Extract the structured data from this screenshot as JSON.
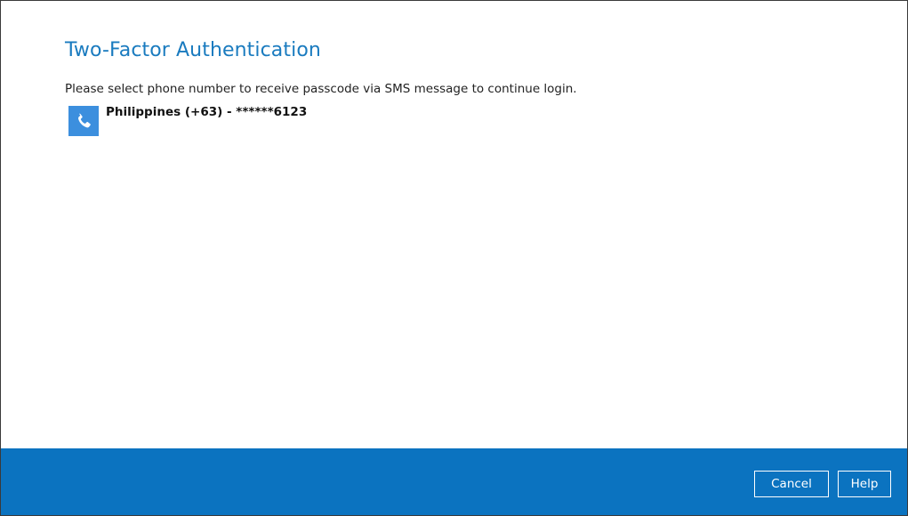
{
  "dialog": {
    "title": "Two-Factor Authentication",
    "instruction": "Please select phone number to receive passcode via SMS message to continue login."
  },
  "phone_options": [
    {
      "icon": "phone-icon",
      "label": "Philippines (+63) - ******6123"
    }
  ],
  "footer": {
    "cancel_label": "Cancel",
    "help_label": "Help"
  },
  "colors": {
    "title": "#1a7bbf",
    "footer_bg": "#0b73c0",
    "icon_bg": "#3c8fde"
  }
}
